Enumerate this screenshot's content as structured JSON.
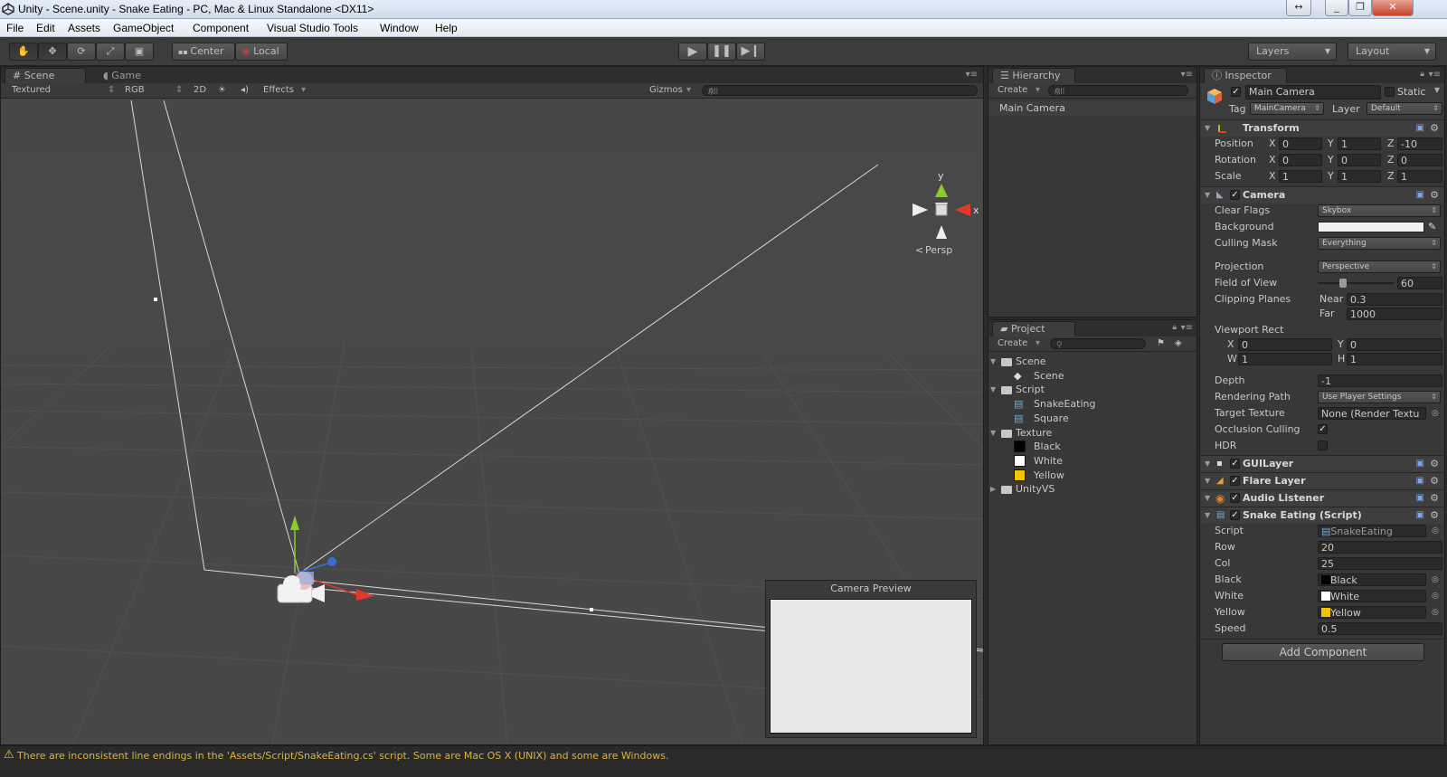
{
  "window": {
    "title": "Unity - Scene.unity - Snake Eating - PC, Mac & Linux Standalone <DX11>",
    "controls": [
      "↔",
      "_",
      "❐",
      "✕"
    ]
  },
  "menu": [
    "File",
    "Edit",
    "Assets",
    "GameObject",
    "Component",
    "Visual Studio Tools",
    "Window",
    "Help"
  ],
  "toolbar": {
    "pivot": "Center",
    "space": "Local",
    "layers": "Layers",
    "layout": "Layout"
  },
  "scene": {
    "tabs": [
      "Scene",
      "Game"
    ],
    "shading": "Textured",
    "render_mode": "RGB",
    "mode_2d": "2D",
    "effects": "Effects",
    "gizmos": "Gizmos",
    "search_placeholder": "All",
    "gizmo_y": "y",
    "gizmo_x": "x",
    "persp": "Persp",
    "camera_preview": "Camera Preview"
  },
  "hierarchy": {
    "tab": "Hierarchy",
    "create": "Create",
    "search_placeholder": "All",
    "items": [
      "Main Camera"
    ]
  },
  "project": {
    "tab": "Project",
    "create": "Create",
    "tree": [
      {
        "label": "Scene",
        "kind": "folder",
        "depth": 0
      },
      {
        "label": "Scene",
        "kind": "unity",
        "depth": 1
      },
      {
        "label": "Script",
        "kind": "folder",
        "depth": 0
      },
      {
        "label": "SnakeEating",
        "kind": "script",
        "depth": 1
      },
      {
        "label": "Square",
        "kind": "script",
        "depth": 1
      },
      {
        "label": "Texture",
        "kind": "folder",
        "depth": 0
      },
      {
        "label": "Black",
        "kind": "swatch",
        "color": "#000000",
        "depth": 1
      },
      {
        "label": "White",
        "kind": "swatch",
        "color": "#ffffff",
        "depth": 1
      },
      {
        "label": "Yellow",
        "kind": "swatch",
        "color": "#f5c400",
        "depth": 1
      },
      {
        "label": "UnityVS",
        "kind": "folder-collapsed",
        "depth": 0
      }
    ]
  },
  "inspector": {
    "tab": "Inspector",
    "object_name": "Main Camera",
    "static_label": "Static",
    "tag_label": "Tag",
    "tag_value": "MainCamera",
    "layer_label": "Layer",
    "layer_value": "Default",
    "transform": {
      "title": "Transform",
      "position_label": "Position",
      "rotation_label": "Rotation",
      "scale_label": "Scale",
      "position": [
        "0",
        "1",
        "-10"
      ],
      "rotation": [
        "0",
        "0",
        "0"
      ],
      "scale": [
        "1",
        "1",
        "1"
      ],
      "axes": [
        "X",
        "Y",
        "Z"
      ]
    },
    "camera": {
      "title": "Camera",
      "clear_flags_label": "Clear Flags",
      "clear_flags": "Skybox",
      "background_label": "Background",
      "culling_mask_label": "Culling Mask",
      "culling_mask": "Everything",
      "projection_label": "Projection",
      "projection": "Perspective",
      "fov_label": "Field of View",
      "fov": "60",
      "fov_fraction": 0.33,
      "clipping_label": "Clipping Planes",
      "near_label": "Near",
      "near": "0.3",
      "far_label": "Far",
      "far": "1000",
      "viewport_label": "Viewport Rect",
      "vp_x_label": "X",
      "vp_x": "0",
      "vp_y_label": "Y",
      "vp_y": "0",
      "vp_w_label": "W",
      "vp_w": "1",
      "vp_h_label": "H",
      "vp_h": "1",
      "depth_label": "Depth",
      "depth": "-1",
      "rendering_path_label": "Rendering Path",
      "rendering_path": "Use Player Settings",
      "target_texture_label": "Target Texture",
      "target_texture": "None (Render Textu",
      "occlusion_label": "Occlusion Culling",
      "occlusion_checked": true,
      "hdr_label": "HDR",
      "hdr_checked": false
    },
    "gui_layer": "GUILayer",
    "flare_layer": "Flare Layer",
    "audio_listener": "Audio Listener",
    "script_comp": {
      "title": "Snake Eating (Script)",
      "script_label": "Script",
      "script": "SnakeEating",
      "row_label": "Row",
      "row": "20",
      "col_label": "Col",
      "col": "25",
      "black_label": "Black",
      "black": "Black",
      "white_label": "White",
      "white": "White",
      "yellow_label": "Yellow",
      "yellow": "Yellow",
      "speed_label": "Speed",
      "speed": "0.5"
    },
    "add_component": "Add Component"
  },
  "status": {
    "message": "There are inconsistent line endings in the 'Assets/Script/SnakeEating.cs' script. Some are Mac OS X (UNIX) and some are Windows."
  },
  "colors": {
    "accent_yellow": "#f5c400",
    "warning_text": "#d9b53d",
    "axis_x": "#e03a2a",
    "axis_y": "#8ccc2a",
    "axis_z": "#3a6cd8"
  }
}
